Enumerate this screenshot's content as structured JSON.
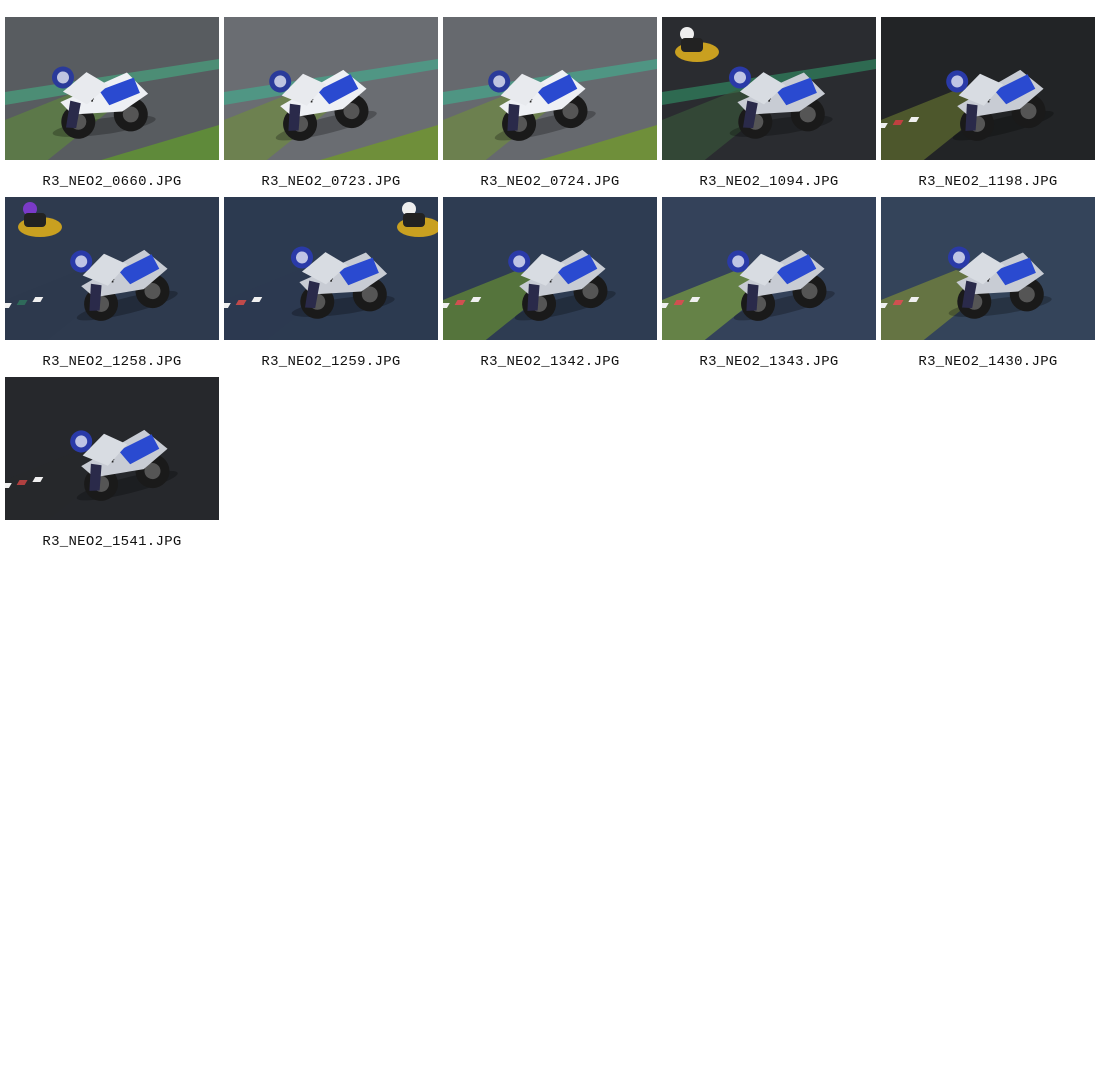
{
  "gallery": {
    "items": [
      {
        "filename": "R3_NEO2_0660.JPG",
        "track": "#585c60",
        "infield": "#5f8a3a",
        "stripe": "#4a9a7a",
        "tone": "light"
      },
      {
        "filename": "R3_NEO2_0723.JPG",
        "track": "#6a6d72",
        "infield": "#6f8f3a",
        "stripe": "#4aa088",
        "tone": "light"
      },
      {
        "filename": "R3_NEO2_0724.JPG",
        "track": "#66696e",
        "infield": "#6f8f3a",
        "stripe": "#4aa088",
        "tone": "light"
      },
      {
        "filename": "R3_NEO2_1094.JPG",
        "track": "#2a2c30",
        "infield": "#3a5a3a",
        "stripe": "#2f7a5a",
        "tone": "dark"
      },
      {
        "filename": "R3_NEO2_1198.JPG",
        "track": "#222426",
        "infield": "#6a7a30",
        "stripe": "#c04040",
        "tone": "dark"
      },
      {
        "filename": "R3_NEO2_1258.JPG",
        "track": "#2e3a4e",
        "infield": "#2e3a4e",
        "stripe": "#2f6a5a",
        "tone": "blue"
      },
      {
        "filename": "R3_NEO2_1259.JPG",
        "track": "#2c3a50",
        "infield": "#2c3a50",
        "stripe": "#c04a4a",
        "tone": "blue"
      },
      {
        "filename": "R3_NEO2_1342.JPG",
        "track": "#2e3c52",
        "infield": "#5a7a3a",
        "stripe": "#d05050",
        "tone": "blue"
      },
      {
        "filename": "R3_NEO2_1343.JPG",
        "track": "#34425a",
        "infield": "#6a8a45",
        "stripe": "#d05050",
        "tone": "blue"
      },
      {
        "filename": "R3_NEO2_1430.JPG",
        "track": "#34445a",
        "infield": "#6a7a40",
        "stripe": "#d05050",
        "tone": "blue"
      },
      {
        "filename": "R3_NEO2_1541.JPG",
        "track": "#26282c",
        "infield": "#26282c",
        "stripe": "#b04040",
        "tone": "dark"
      }
    ]
  }
}
